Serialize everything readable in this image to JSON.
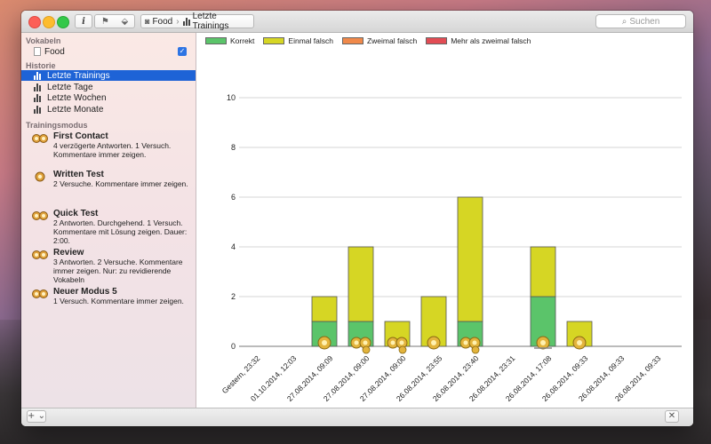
{
  "toolbar": {
    "info_label": "i",
    "path": [
      "Food",
      "Letzte Trainings"
    ],
    "search_placeholder": "Suchen"
  },
  "sidebar": {
    "vokabeln_heading": "Vokabeln",
    "vocab_item": "Food",
    "historie_heading": "Historie",
    "historie_items": [
      "Letzte Trainings",
      "Letzte Tage",
      "Letzte Wochen",
      "Letzte Monate"
    ],
    "trainingsmodus_heading": "Trainingsmodus",
    "modes": [
      {
        "title": "First Contact",
        "desc": "4 verzögerte Antworten. 1 Versuch. Kommentare immer zeigen."
      },
      {
        "title": "Written Test",
        "desc": "2 Versuche. Kommentare immer zeigen."
      },
      {
        "title": "Quick Test",
        "desc": "2 Antworten. Durchgehend. 1 Versuch. Kommentare mit Lösung zeigen. Dauer: 2:00."
      },
      {
        "title": "Review",
        "desc": "3 Antworten. 2 Versuche. Kommentare immer zeigen. Nur: zu revidierende Vokabeln"
      },
      {
        "title": "Neuer Modus 5",
        "desc": "1 Versuch. Kommentare immer zeigen."
      }
    ]
  },
  "bottom": {
    "add_label": "+ ⌄",
    "close_label": "✕"
  },
  "colors": {
    "korrekt": "#5bc46a",
    "einmal": "#d6d624",
    "zweimal": "#f0894a",
    "mehr": "#e24c54",
    "selection": "#1e63d6"
  },
  "chart_data": {
    "type": "bar",
    "stacked": true,
    "categories": [
      "Gestern, 23:32",
      "01.10.2014, 12:03",
      "27.08.2014, 09:09",
      "27.08.2014, 09:00",
      "27.08.2014, 09:00",
      "26.08.2014, 23:55",
      "26.08.2014, 23:40",
      "26.08.2014, 23:31",
      "26.08.2014, 17:08",
      "26.08.2014, 09:33",
      "26.08.2014, 09:33",
      "26.08.2014, 09:33"
    ],
    "series": [
      {
        "name": "Korrekt",
        "color": "#5bc46a",
        "values": [
          0,
          0,
          1,
          1,
          0,
          0,
          1,
          0,
          2,
          0,
          0,
          0
        ]
      },
      {
        "name": "Einmal falsch",
        "color": "#d6d624",
        "values": [
          0,
          0,
          1,
          3,
          1,
          2,
          5,
          0,
          2,
          1,
          0,
          0
        ]
      },
      {
        "name": "Zweimal falsch",
        "color": "#f0894a",
        "values": [
          0,
          0,
          0,
          0,
          0,
          0,
          0,
          0,
          0,
          0,
          0,
          0
        ]
      },
      {
        "name": "Mehr als zweimal falsch",
        "color": "#e24c54",
        "values": [
          0,
          0,
          0,
          0,
          0,
          0,
          0,
          0,
          0,
          0,
          0,
          0
        ]
      }
    ],
    "mode_icons": [
      "",
      "",
      "single",
      "double",
      "double",
      "single",
      "double",
      "",
      "review",
      "single",
      "",
      ""
    ],
    "yticks": [
      0,
      2,
      4,
      6,
      8,
      10
    ],
    "ylim": [
      0,
      10
    ],
    "grid": true,
    "legend_position": "top-left"
  }
}
